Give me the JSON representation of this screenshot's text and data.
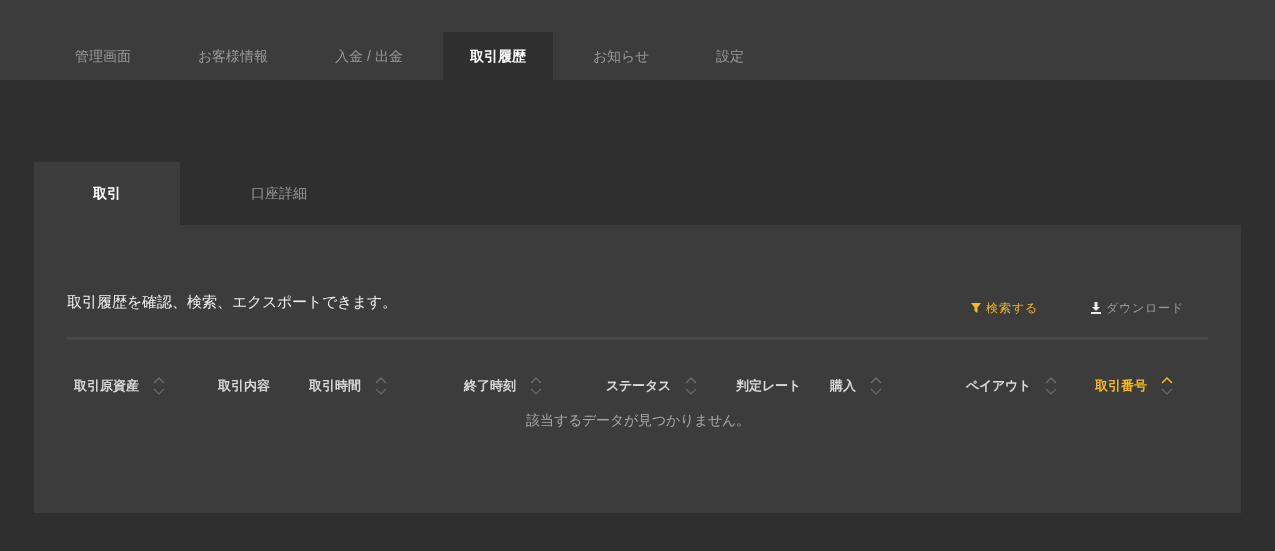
{
  "nav_tabs": [
    {
      "label": "管理画面",
      "selected": false
    },
    {
      "label": "お客様情報",
      "selected": false
    },
    {
      "label": "入金 / 出金",
      "selected": false
    },
    {
      "label": "取引履歴",
      "selected": true
    },
    {
      "label": "お知らせ",
      "selected": false
    },
    {
      "label": "設定",
      "selected": false
    }
  ],
  "sub_tabs": [
    {
      "label": "取引",
      "selected": true
    },
    {
      "label": "口座詳細",
      "selected": false
    }
  ],
  "description": "取引履歴を確認、検索、エクスポートできます。",
  "actions": [
    {
      "kind": "search",
      "label": "検索する"
    },
    {
      "kind": "download",
      "label": "ダウンロード"
    }
  ],
  "table": {
    "columns": [
      {
        "label": "取引原資産",
        "sortable": true,
        "sorted": false
      },
      {
        "label": "取引内容",
        "sortable": false,
        "sorted": false
      },
      {
        "label": "取引時間",
        "sortable": true,
        "sorted": false
      },
      {
        "label": "終了時刻",
        "sortable": true,
        "sorted": false
      },
      {
        "label": "ステータス",
        "sortable": true,
        "sorted": false
      },
      {
        "label": "判定レート",
        "sortable": false,
        "sorted": false
      },
      {
        "label": "購入",
        "sortable": true,
        "sorted": false
      },
      {
        "label": "ペイアウト",
        "sortable": true,
        "sorted": false
      },
      {
        "label": "取引番号",
        "sortable": true,
        "sorted": true
      }
    ],
    "empty_message": "該当するデータが見つかりません。"
  }
}
